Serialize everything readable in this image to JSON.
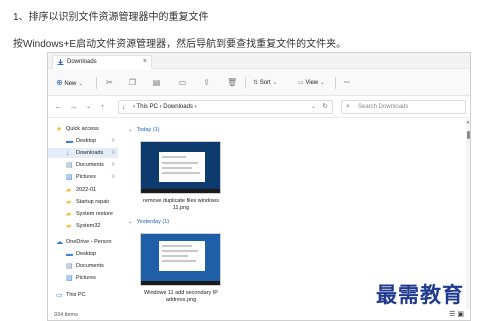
{
  "article": {
    "line1": "1、排序以识别文件资源管理器中的重复文件",
    "line2": "按Windows+E启动文件资源管理器，然后导航到要查找重复文件的文件夹。"
  },
  "titlebar": {
    "tab_label": "Downloads",
    "close_glyph": "×"
  },
  "toolbar": {
    "new_label": "New",
    "sort_label": "Sort",
    "view_label": "View",
    "more_glyph": "···"
  },
  "addressbar": {
    "path_root": "This PC",
    "path_sep": "›",
    "path_folder": "Downloads",
    "search_placeholder": "Search Downloads"
  },
  "sidebar": {
    "items": [
      {
        "label": "Quick access",
        "icon": "star-icon",
        "color": "#f2c12e"
      },
      {
        "label": "Desktop",
        "icon": "desktop-icon",
        "color": "#3a86d6"
      },
      {
        "label": "Downloads",
        "icon": "download-icon",
        "color": "#3a86d6"
      },
      {
        "label": "Documents",
        "icon": "document-icon",
        "color": "#6b8cae"
      },
      {
        "label": "Pictures",
        "icon": "picture-icon",
        "color": "#3a86d6"
      },
      {
        "label": "2022-01",
        "icon": "folder-icon",
        "color": "#f0c24b"
      },
      {
        "label": "Startup repair",
        "icon": "folder-icon",
        "color": "#f0c24b"
      },
      {
        "label": "System restore",
        "icon": "folder-icon",
        "color": "#f0c24b"
      },
      {
        "label": "System32",
        "icon": "folder-icon",
        "color": "#f0c24b"
      },
      {
        "label": "OneDrive - Person",
        "icon": "cloud-icon",
        "color": "#2b78d0"
      },
      {
        "label": "Desktop",
        "icon": "desktop-icon",
        "color": "#3a86d6"
      },
      {
        "label": "Documents",
        "icon": "document-icon",
        "color": "#6b8cae"
      },
      {
        "label": "Pictures",
        "icon": "picture-icon",
        "color": "#3a86d6"
      },
      {
        "label": "This PC",
        "icon": "computer-icon",
        "color": "#3a86d6"
      }
    ]
  },
  "content": {
    "groups": [
      {
        "header": "Today (1)",
        "file": "remove duplicate files windows 11.png"
      },
      {
        "header": "Yesterday (1)",
        "file": "Windows 11 add secondary IP address.png"
      }
    ]
  },
  "statusbar": {
    "count": "934 items"
  },
  "watermark": {
    "text": "最需教育"
  },
  "colors": {
    "accent": "#1a5fb4",
    "watermark": "#1f3a8f"
  }
}
